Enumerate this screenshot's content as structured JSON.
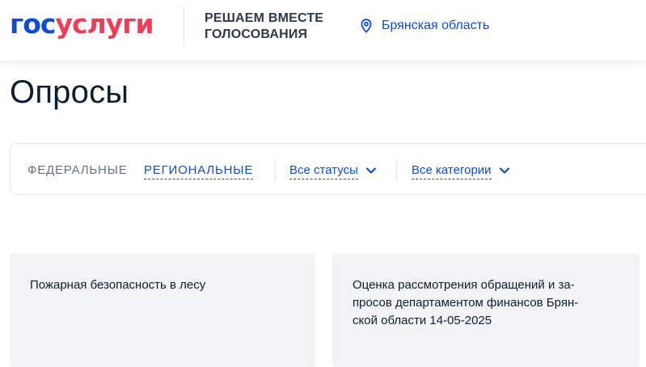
{
  "header": {
    "logo_part1": "гос",
    "logo_part2": "услуги",
    "tagline": "РЕШАЕМ ВМЕСТЕ\nГОЛОСОВАНИЯ",
    "region": "Брянская область"
  },
  "page": {
    "title": "Опросы"
  },
  "filters": {
    "tabs": [
      {
        "label": "ФЕДЕРАЛЬНЫЕ",
        "active": false
      },
      {
        "label": "РЕГИОНАЛЬНЫЕ",
        "active": true
      }
    ],
    "status_dropdown": {
      "label": "Все статусы"
    },
    "category_dropdown": {
      "label": "Все категории"
    }
  },
  "cards": [
    {
      "lines": [
        "Пожарная безопасность в лесу"
      ]
    },
    {
      "lines": [
        "Оценка рассмотрения обращений и за-",
        "просов департаментом финансов Брян-",
        "ской области 14-05-2025"
      ]
    }
  ],
  "colors": {
    "brand_blue": "#0d4cd3",
    "brand_red": "#ee3f58",
    "card_bg": "#f1f3f6",
    "text_primary": "#0b1f33",
    "text_muted": "#66727f"
  },
  "icons": {
    "region": "location-pin-icon",
    "dropdown": "chevron-down-icon"
  }
}
